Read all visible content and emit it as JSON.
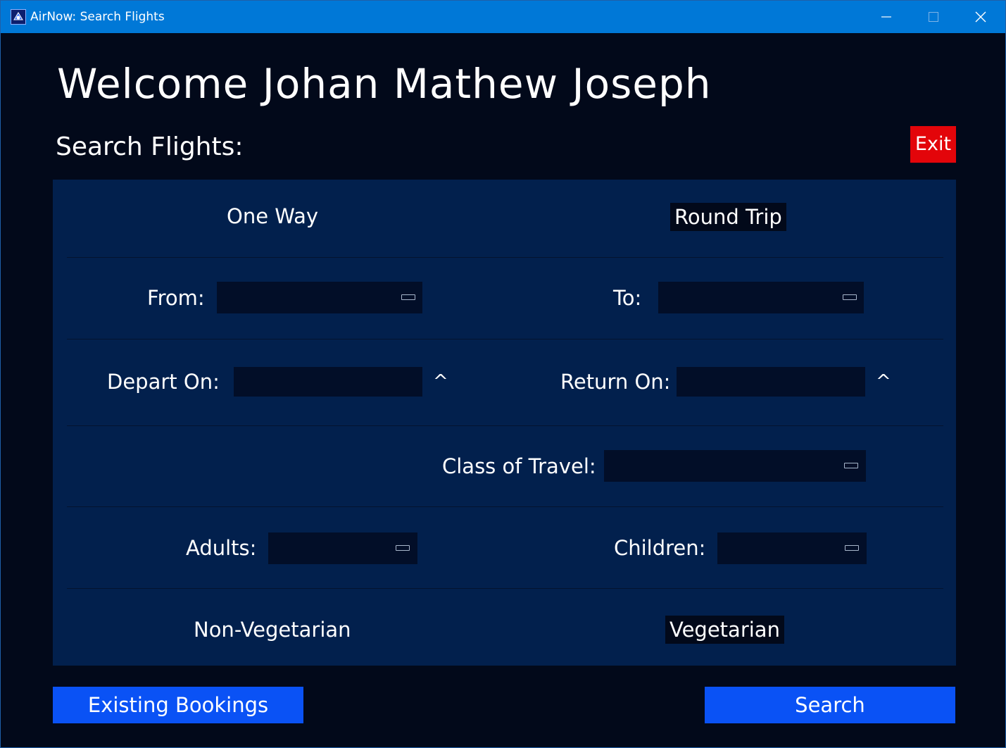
{
  "window": {
    "title": "AirNow: Search Flights"
  },
  "header": {
    "welcome": "Welcome Johan Mathew Joseph",
    "subtitle": "Search Flights:",
    "exit_label": "Exit"
  },
  "trip_type": {
    "one_way": "One Way",
    "round_trip": "Round Trip",
    "selected": "Round Trip"
  },
  "form": {
    "from_label": "From:",
    "from_value": "",
    "to_label": "To:",
    "to_value": "",
    "depart_label": "Depart On:",
    "depart_value": "",
    "return_label": "Return On:",
    "return_value": "",
    "date_toggle": "^",
    "class_label": "Class of Travel:",
    "class_value": "",
    "adults_label": "Adults:",
    "adults_value": "",
    "children_label": "Children:",
    "children_value": ""
  },
  "meal": {
    "non_veg": "Non-Vegetarian",
    "veg": "Vegetarian",
    "selected": "Vegetarian"
  },
  "actions": {
    "existing_bookings": "Existing Bookings",
    "search": "Search"
  },
  "colors": {
    "title_bar": "#0078d7",
    "background": "#02091a",
    "panel": "#02204d",
    "field": "#020e28",
    "exit": "#e3050a",
    "primary_button": "#0a52f5"
  },
  "icons": {
    "app": "airnow-app-icon",
    "minimize": "minimize-icon",
    "maximize": "maximize-icon",
    "close": "close-icon",
    "dropdown": "dropdown-icon"
  }
}
